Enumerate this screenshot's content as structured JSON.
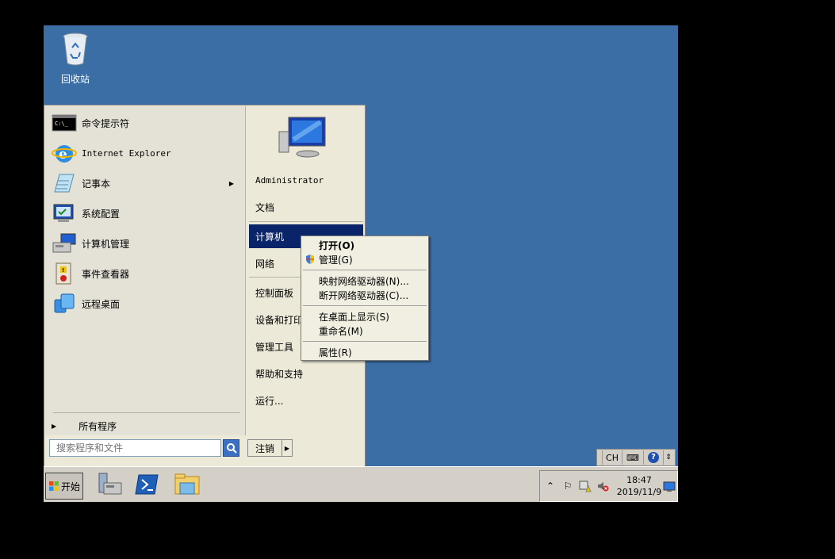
{
  "desktop": {
    "recycle_bin_label": "回收站"
  },
  "start_menu": {
    "pinned": [
      {
        "label": "命令提示符",
        "icon": "cmd-icon"
      },
      {
        "label": "Internet Explorer",
        "icon": "ie-icon"
      },
      {
        "label": "记事本",
        "icon": "notepad-icon",
        "submenu": true
      },
      {
        "label": "系统配置",
        "icon": "msconfig-icon"
      },
      {
        "label": "计算机管理",
        "icon": "computer-management-icon"
      },
      {
        "label": "事件查看器",
        "icon": "event-viewer-icon"
      },
      {
        "label": "远程桌面",
        "icon": "remote-desktop-icon"
      }
    ],
    "all_programs": "所有程序",
    "search_placeholder": "搜索程序和文件",
    "right": {
      "user": "Administrator",
      "documents": "文档",
      "computer": "计算机",
      "network": "网络",
      "control_panel": "控制面板",
      "devices": "设备和打印",
      "admin_tools": "管理工具",
      "help": "帮助和支持",
      "run": "运行..."
    },
    "logoff": "注销"
  },
  "context_menu": {
    "open": "打开(O)",
    "manage": "管理(G)",
    "map_drive": "映射网络驱动器(N)...",
    "disconnect_drive": "断开网络驱动器(C)...",
    "show_on_desktop": "在桌面上显示(S)",
    "rename": "重命名(M)",
    "properties": "属性(R)"
  },
  "taskbar": {
    "start_label": "开始",
    "clock_time": "18:47",
    "clock_date": "2019/11/9",
    "lang": "CH"
  },
  "colors": {
    "desktop": "#3a6ea5",
    "selection": "#0a246a"
  }
}
